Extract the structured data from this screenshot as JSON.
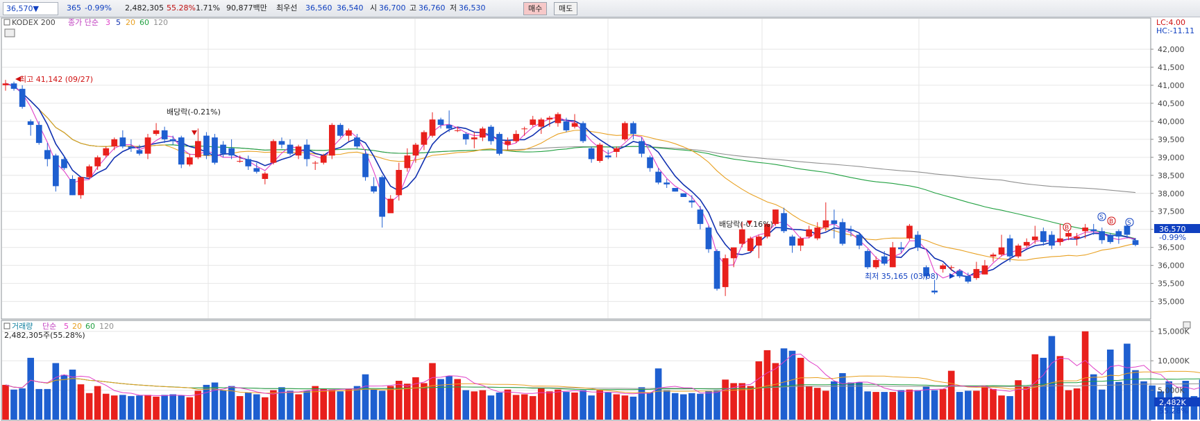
{
  "ticker_bar": {
    "price": "36,570▼",
    "change": "365",
    "change_pct": "-0.99%",
    "volume": "2,482,305",
    "volume_ratio": "55.28%",
    "turnover_pct": "1.71%",
    "amount": "90,877백만",
    "bid_label": "최우선",
    "ask_price": "36,560",
    "bid_price": "36,540",
    "open_label": "시",
    "open": "36,700",
    "high_label": "고",
    "high": "36,760",
    "low_label": "저",
    "low": "36,530",
    "buy_button": "매수",
    "sell_button": "매도"
  },
  "price_panel": {
    "name": "KODEX 200",
    "ma_label": "종가 단순",
    "ma_periods": [
      "3",
      "5",
      "20",
      "60",
      "120"
    ],
    "lc_label": "LC:4.00",
    "hc_label": "HC:-11.11",
    "high_note": "최고 41,142 (09/27)",
    "low_note": "최저 35,165 (03/08)",
    "div_note_1": "배당락(-0.21%)",
    "div_note_2": "배당락(-0.16%)",
    "current_price_label": "36,570",
    "current_change_label": "-0.99%",
    "y_ticks": [
      "42,000",
      "41,500",
      "41,000",
      "40,500",
      "40,000",
      "39,500",
      "39,000",
      "38,500",
      "38,000",
      "37,500",
      "37,000",
      "36,500",
      "36,000",
      "35,500",
      "35,000"
    ],
    "ma_colors": {
      "ma3": "#e040c8",
      "ma5": "#1030b0",
      "ma20": "#e8a020",
      "ma60": "#20a040",
      "ma120": "#909090"
    },
    "up_color": "#e8201c",
    "down_color": "#1e5fd0",
    "signal_markers": [
      "B",
      "S",
      "B",
      "S"
    ]
  },
  "volume_panel": {
    "label": "거래량",
    "ma_label": "단순",
    "ma_periods": [
      "5",
      "20",
      "60",
      "120"
    ],
    "info": "2,482,305주(55.28%)",
    "y_ticks": [
      "15,000K",
      "10,000K",
      "5,000K"
    ],
    "current_label": "2,482K",
    "current_pct": "55.28%"
  },
  "chart_data": {
    "type": "candlestick",
    "ylim": [
      34800,
      42500
    ],
    "candles": [
      [
        41000,
        41150,
        40850,
        41050
      ],
      [
        41050,
        41100,
        40850,
        40900
      ],
      [
        40900,
        41000,
        40350,
        40400
      ],
      [
        40000,
        40050,
        39600,
        39900
      ],
      [
        39900,
        40000,
        39350,
        39400
      ],
      [
        39200,
        39400,
        38750,
        38950
      ],
      [
        39050,
        39100,
        38050,
        38200
      ],
      [
        38950,
        39050,
        38650,
        38700
      ],
      [
        38400,
        38500,
        37950,
        37950
      ],
      [
        37950,
        38400,
        37850,
        38450
      ],
      [
        38450,
        38800,
        38400,
        38750
      ],
      [
        38750,
        39050,
        38650,
        39000
      ],
      [
        39050,
        39300,
        39000,
        39250
      ],
      [
        39300,
        39550,
        39200,
        39500
      ],
      [
        39550,
        39750,
        39250,
        39300
      ],
      [
        39300,
        39500,
        39150,
        39250
      ],
      [
        39200,
        39350,
        39050,
        39100
      ],
      [
        39100,
        39650,
        38950,
        39550
      ],
      [
        39650,
        39950,
        39600,
        39750
      ],
      [
        39750,
        39850,
        39400,
        39500
      ],
      [
        39500,
        39600,
        39350,
        39450
      ],
      [
        39550,
        39600,
        38700,
        38800
      ],
      [
        38800,
        39100,
        38750,
        39000
      ],
      [
        39000,
        39800,
        38950,
        39450
      ],
      [
        39600,
        39700,
        38950,
        39050
      ],
      [
        39550,
        39650,
        38800,
        38850
      ],
      [
        39350,
        39450,
        39000,
        39100
      ],
      [
        39250,
        39500,
        38950,
        39050
      ],
      [
        38900,
        39050,
        38850,
        38900
      ],
      [
        38950,
        39050,
        38650,
        38750
      ],
      [
        38700,
        38850,
        38550,
        38600
      ],
      [
        38400,
        38600,
        38250,
        38550
      ],
      [
        38850,
        39500,
        38800,
        39450
      ],
      [
        39450,
        39550,
        39250,
        39350
      ],
      [
        39350,
        39500,
        39050,
        39100
      ],
      [
        39050,
        39350,
        38950,
        39300
      ],
      [
        39350,
        39500,
        38750,
        38950
      ],
      [
        38850,
        38900,
        38650,
        38850
      ],
      [
        38850,
        39100,
        38800,
        39050
      ],
      [
        39050,
        39950,
        38950,
        39900
      ],
      [
        39900,
        39950,
        39550,
        39600
      ],
      [
        39600,
        39800,
        39450,
        39750
      ],
      [
        39550,
        39650,
        39250,
        39300
      ],
      [
        39100,
        39200,
        38350,
        38450
      ],
      [
        38200,
        38450,
        38000,
        38050
      ],
      [
        38450,
        38500,
        37050,
        37350
      ],
      [
        37450,
        37950,
        37500,
        37850
      ],
      [
        37950,
        38850,
        37800,
        38650
      ],
      [
        38700,
        39250,
        38600,
        39050
      ],
      [
        39050,
        39400,
        38850,
        39350
      ],
      [
        39350,
        39750,
        39200,
        39700
      ],
      [
        39600,
        40250,
        39550,
        40050
      ],
      [
        40050,
        40100,
        39800,
        39900
      ],
      [
        39900,
        40300,
        39700,
        39800
      ],
      [
        39750,
        39850,
        39700,
        39750
      ],
      [
        39650,
        39700,
        39350,
        39500
      ],
      [
        39500,
        39700,
        39250,
        39550
      ],
      [
        39550,
        39850,
        39450,
        39800
      ],
      [
        39850,
        39900,
        39350,
        39450
      ],
      [
        39650,
        39700,
        39050,
        39100
      ],
      [
        39350,
        39550,
        39200,
        39450
      ],
      [
        39450,
        39750,
        39400,
        39650
      ],
      [
        39800,
        39850,
        39600,
        39800
      ],
      [
        39900,
        40150,
        39850,
        40050
      ],
      [
        39850,
        40100,
        39650,
        40050
      ],
      [
        40050,
        40150,
        39850,
        40100
      ],
      [
        39950,
        40250,
        39850,
        40200
      ],
      [
        40000,
        40100,
        39700,
        39750
      ],
      [
        39850,
        40200,
        39800,
        39950
      ],
      [
        39950,
        40000,
        39400,
        39450
      ],
      [
        39250,
        39300,
        38850,
        38950
      ],
      [
        38900,
        39400,
        38850,
        39350
      ],
      [
        39050,
        39200,
        38950,
        39000
      ],
      [
        39150,
        39300,
        39000,
        39250
      ],
      [
        39500,
        40000,
        39450,
        39950
      ],
      [
        39950,
        40000,
        39500,
        39650
      ],
      [
        39450,
        39550,
        39000,
        39100
      ],
      [
        39000,
        39050,
        38600,
        38700
      ],
      [
        38600,
        38700,
        38250,
        38300
      ],
      [
        38300,
        38400,
        38150,
        38250
      ],
      [
        38150,
        38150,
        38050,
        38050
      ],
      [
        38000,
        38000,
        37900,
        37900
      ],
      [
        37800,
        37950,
        37600,
        37750
      ],
      [
        37550,
        37650,
        37000,
        37150
      ],
      [
        37050,
        37100,
        36350,
        36450
      ],
      [
        36400,
        36450,
        35300,
        35350
      ],
      [
        35400,
        36300,
        35150,
        36200
      ],
      [
        36200,
        36500,
        35950,
        36500
      ],
      [
        36600,
        37200,
        36500,
        37000
      ],
      [
        36400,
        36800,
        36350,
        36750
      ],
      [
        36550,
        36850,
        36200,
        36800
      ],
      [
        36800,
        37200,
        36750,
        37150
      ],
      [
        37150,
        37550,
        37100,
        37550
      ],
      [
        37450,
        37600,
        36900,
        36950
      ],
      [
        36800,
        36850,
        36350,
        36550
      ],
      [
        36550,
        36800,
        36400,
        36750
      ],
      [
        36800,
        37100,
        36750,
        37000
      ],
      [
        36750,
        37200,
        36700,
        37050
      ],
      [
        37050,
        37750,
        36950,
        37250
      ],
      [
        37250,
        37550,
        36750,
        37150
      ],
      [
        37200,
        37300,
        36550,
        36600
      ],
      [
        37000,
        37100,
        36800,
        36950
      ],
      [
        36850,
        36900,
        36450,
        36550
      ],
      [
        36400,
        36450,
        35900,
        35950
      ],
      [
        35950,
        36250,
        35900,
        36150
      ],
      [
        36250,
        36400,
        36000,
        36050
      ],
      [
        35950,
        36650,
        35950,
        36500
      ],
      [
        36500,
        36650,
        36350,
        36450
      ],
      [
        36750,
        37150,
        36700,
        37100
      ],
      [
        36850,
        36950,
        36400,
        36500
      ],
      [
        35950,
        36000,
        35600,
        35700
      ],
      [
        35300,
        35600,
        35200,
        35250
      ],
      [
        35900,
        36050,
        35800,
        36000
      ],
      [
        35950,
        36000,
        35850,
        35950
      ],
      [
        35850,
        35900,
        35650,
        35700
      ],
      [
        35700,
        35800,
        35500,
        35550
      ],
      [
        35650,
        36100,
        35600,
        35900
      ],
      [
        35750,
        36150,
        35750,
        36000
      ],
      [
        36250,
        36350,
        36100,
        36300
      ],
      [
        36300,
        36850,
        36250,
        36500
      ],
      [
        36750,
        36850,
        36100,
        36250
      ],
      [
        36250,
        36600,
        36200,
        36550
      ],
      [
        36550,
        36750,
        36500,
        36650
      ],
      [
        36700,
        37100,
        36600,
        36800
      ],
      [
        36950,
        37050,
        36550,
        36650
      ],
      [
        36850,
        36950,
        36450,
        36550
      ],
      [
        36650,
        37150,
        36550,
        36750
      ],
      [
        36800,
        37100,
        36700,
        36900
      ],
      [
        36750,
        36900,
        36550,
        36800
      ],
      [
        36950,
        37150,
        36750,
        37050
      ],
      [
        37000,
        37150,
        36850,
        36950
      ],
      [
        36950,
        37050,
        36600,
        36700
      ],
      [
        36850,
        36900,
        36600,
        36650
      ],
      [
        36950,
        37000,
        36600,
        36800
      ],
      [
        37100,
        37150,
        36750,
        36850
      ],
      [
        36700,
        36760,
        36530,
        36570
      ]
    ],
    "volume_k": [
      5900,
      5100,
      5300,
      10500,
      5200,
      5200,
      9600,
      7600,
      8500,
      6000,
      4500,
      5700,
      4400,
      4100,
      4200,
      4000,
      4100,
      4200,
      3900,
      4200,
      4300,
      4100,
      3800,
      4900,
      5900,
      6300,
      5000,
      5700,
      4000,
      4600,
      4300,
      3800,
      5000,
      5500,
      4900,
      4300,
      4900,
      5700,
      5200,
      5100,
      4800,
      5200,
      5700,
      7700,
      5100,
      4900,
      5700,
      6600,
      6100,
      7200,
      6200,
      9600,
      6900,
      7400,
      6900,
      5000,
      4800,
      5000,
      4100,
      4600,
      5100,
      4200,
      4300,
      4000,
      5400,
      4800,
      5100,
      4700,
      4600,
      5000,
      4100,
      5000,
      4600,
      4300,
      4100,
      3900,
      5500,
      4600,
      8700,
      5000,
      4500,
      4300,
      4500,
      4400,
      4900,
      5000,
      6800,
      6200,
      6200,
      5700,
      9900,
      11800,
      9600,
      12100,
      11700,
      10500,
      5700,
      5400,
      4900,
      6500,
      7900,
      6300,
      6300,
      4800,
      4700,
      4700,
      4700,
      5000,
      5100,
      5000,
      5600,
      5000,
      5200,
      8300,
      4700,
      4900,
      4900,
      5800,
      5200,
      4100,
      4000,
      6700,
      5600,
      11100,
      10500,
      14200,
      10800,
      5000,
      5300,
      15000,
      7700,
      5100,
      11900,
      6400,
      12900,
      8400,
      6500,
      5800,
      4800,
      6500,
      3900,
      6600,
      4000,
      6800,
      5400,
      4500,
      4000,
      5600,
      4100,
      4000,
      4100,
      4200,
      2482
    ]
  }
}
